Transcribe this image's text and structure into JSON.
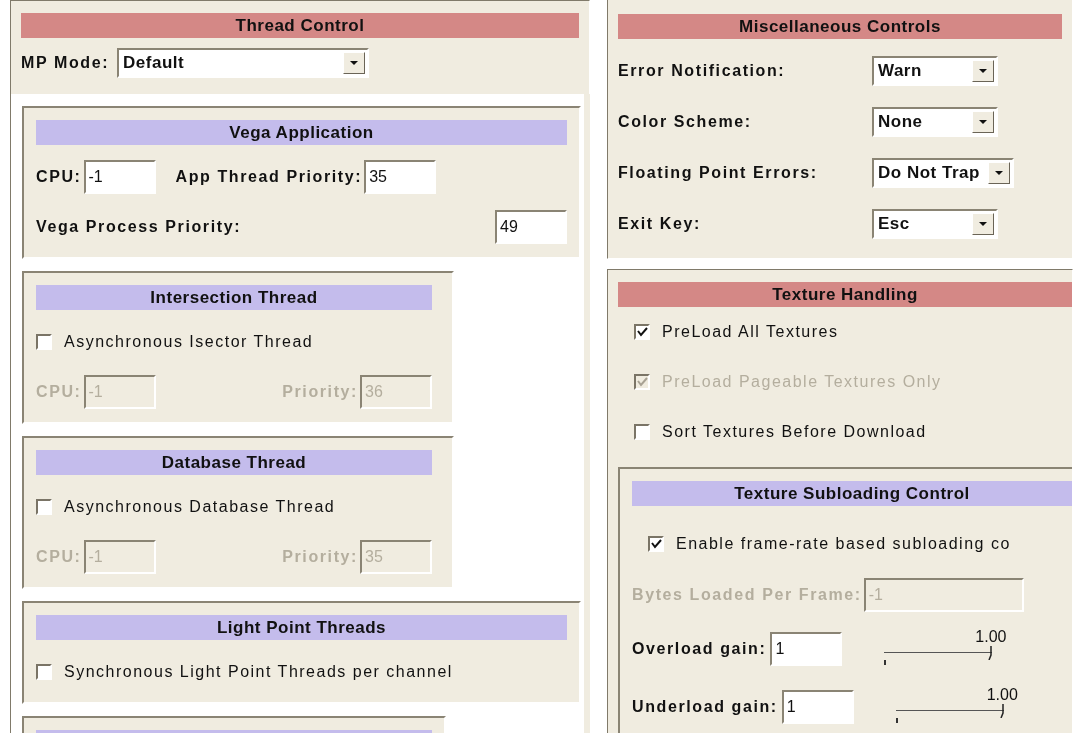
{
  "left": {
    "title": "Thread Control",
    "mp_mode": {
      "label": "MP Mode:",
      "value": "Default"
    },
    "panels": [
      {
        "title": "Vega Application",
        "wide": true,
        "rows": [
          {
            "kind": "fields",
            "spread": false,
            "disabled": false,
            "fields": [
              {
                "label": "CPU:",
                "value": "-1"
              },
              {
                "label": "App Thread Priority:",
                "value": "35"
              }
            ]
          },
          {
            "kind": "fields",
            "spread": true,
            "disabled": false,
            "fields": [
              {
                "label": "Vega Process Priority:",
                "value": "49"
              }
            ]
          }
        ]
      },
      {
        "title": "Intersection Thread",
        "wide": false,
        "rows": [
          {
            "kind": "check",
            "label": "Asynchronous Isector Thread",
            "checked": false,
            "disabled": false
          },
          {
            "kind": "fields",
            "spread": true,
            "disabled": true,
            "fields": [
              {
                "label": "CPU:",
                "value": "-1"
              },
              {
                "label": "Priority:",
                "value": "36"
              }
            ]
          }
        ]
      },
      {
        "title": "Database Thread",
        "wide": false,
        "rows": [
          {
            "kind": "check",
            "label": "Asynchronous Database Thread",
            "checked": false,
            "disabled": false
          },
          {
            "kind": "fields",
            "spread": true,
            "disabled": true,
            "fields": [
              {
                "label": "CPU:",
                "value": "-1"
              },
              {
                "label": "Priority:",
                "value": "35"
              }
            ]
          }
        ]
      },
      {
        "title": "Light Point Threads",
        "wide": true,
        "rows": [
          {
            "kind": "check",
            "label": "Synchronous Light Point Threads per channel",
            "checked": false,
            "disabled": false
          }
        ]
      }
    ],
    "partial_panel": true
  },
  "right": {
    "misc": {
      "title": "Miscellaneous Controls",
      "selects": [
        {
          "label": "Error Notification:",
          "value": "Warn"
        },
        {
          "label": "Color Scheme:",
          "value": "None"
        },
        {
          "label": "Floating Point Errors:",
          "value": "Do Not Trap"
        },
        {
          "label": "Exit Key:",
          "value": "Esc"
        }
      ]
    },
    "texture": {
      "title": "Texture Handling",
      "checks": [
        {
          "label": "PreLoad All Textures",
          "checked": true,
          "disabled": false
        },
        {
          "label": "PreLoad Pageable Textures Only",
          "checked": true,
          "disabled": true
        },
        {
          "label": "Sort Textures Before Download",
          "checked": false,
          "disabled": false
        }
      ],
      "subloading": {
        "title": "Texture Subloading Control",
        "rows": [
          {
            "kind": "check",
            "label": "Enable frame-rate based subloading co",
            "checked": true,
            "disabled": false
          },
          {
            "kind": "fields",
            "spread": false,
            "disabled": true,
            "fields": [
              {
                "label": "Bytes Loaded Per Frame:",
                "value": "-1"
              }
            ]
          },
          {
            "kind": "gain",
            "label": "Overload gain:",
            "value": "1",
            "reading": "1.00",
            "level": 1
          },
          {
            "kind": "gain",
            "label": "Underload gain:",
            "value": "1",
            "reading": "1.00",
            "level": 1
          }
        ]
      }
    }
  }
}
